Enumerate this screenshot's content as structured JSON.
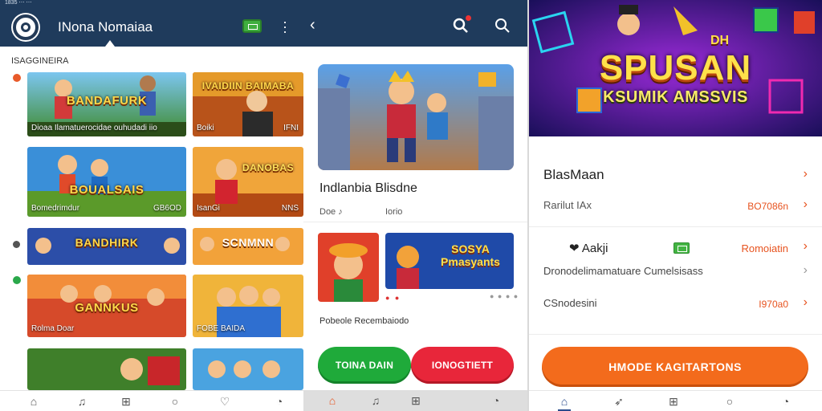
{
  "panel_left": {
    "status_text": "1835 ⋯ ⋯",
    "app_title": "INona Nomaiaa",
    "section_label": "ISAGGINEIRA",
    "tiles": [
      {
        "headline": "BANDAFURK",
        "caption_left": "Dioaa Ilamatuerocidae ouhudadi iio",
        "caption_right": ""
      },
      {
        "headline": "IVAIDIIN BAIMABA",
        "caption_left": "Boiki",
        "caption_right": "IFNI"
      },
      {
        "headline": "BOUALSAIS",
        "caption_left": "Bomedrimdur",
        "caption_right": "GB6OD"
      },
      {
        "headline": "DANOBAS",
        "caption_left": "IsanGi",
        "caption_right": "NNS"
      },
      {
        "headline": "BANDHIRK",
        "caption_left": "",
        "caption_right": ""
      },
      {
        "headline": "SCNMNN",
        "caption_left": "",
        "caption_right": ""
      },
      {
        "headline": "GANNKUS",
        "caption_left": "Rolma Doar",
        "caption_right": ""
      },
      {
        "headline": "",
        "caption_left": "FOBE BAIDA",
        "caption_right": ""
      },
      {
        "headline": "",
        "caption_left": "",
        "caption_right": ""
      },
      {
        "headline": "",
        "caption_left": "",
        "caption_right": ""
      }
    ],
    "bottom_nav": [
      "home-icon",
      "bell-icon",
      "apps-icon",
      "chat-icon",
      "heart-icon",
      "profile-icon"
    ]
  },
  "panel_middle": {
    "title": "Indlanbia Blisdne",
    "meta_left": "Doe ♪",
    "meta_right": "Iorio",
    "small_tile_text": "SOSYA Pmasyants",
    "footer_text": "Pobeole Recembaiodo",
    "button_green": "TOINA DAIN",
    "button_red": "IONOGTIETT",
    "bottom_nav": [
      "home-icon",
      "bell-icon",
      "apps-icon",
      "profile-icon"
    ]
  },
  "panel_right": {
    "banner_title": "SPUSAN",
    "banner_sub": "KSUMIK AMSSVIS",
    "banner_corner": "DH",
    "rows": [
      {
        "label": "BlasMaan",
        "value": ""
      },
      {
        "label": "Rarilut IAx",
        "value": "BO7086n"
      },
      {
        "label": "❤ Aakji",
        "value": "Romoiatin"
      },
      {
        "label": "Dronodelimamatuare Cumelsisass",
        "value": ""
      },
      {
        "label": "CSnodesini",
        "value": "I970a0"
      }
    ],
    "cta_label": "HMODE KAGITARTONS",
    "bottom_nav": [
      "home-icon",
      "send-icon",
      "apps-icon",
      "chat-icon",
      "profile-icon"
    ]
  },
  "colors": {
    "header_navy": "#1f3b5c",
    "accent_orange": "#f36b1c",
    "green_button": "#1faa3a",
    "red_button": "#e8263a"
  }
}
